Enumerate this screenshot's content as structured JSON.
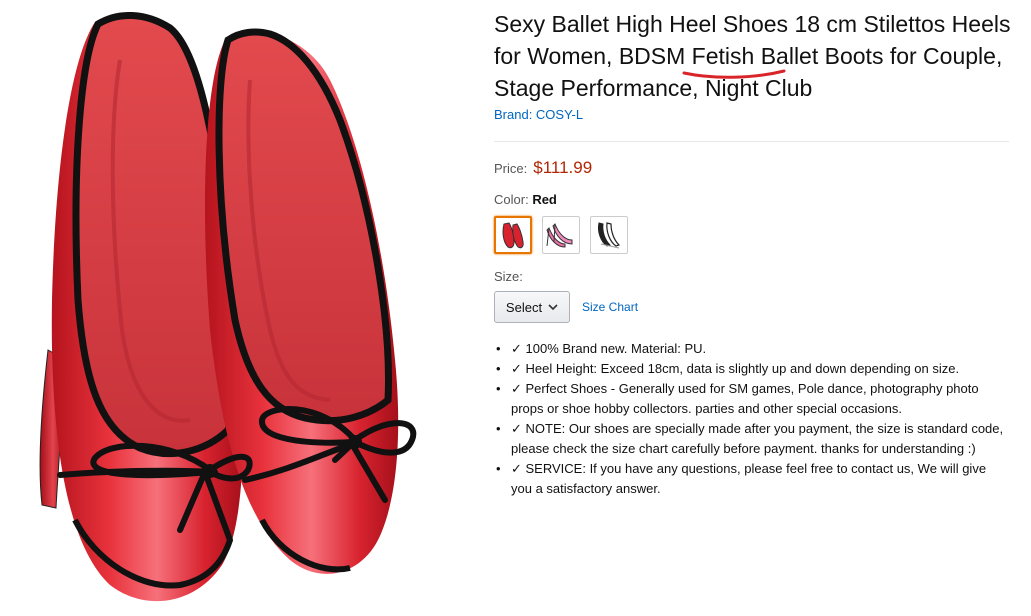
{
  "product": {
    "title": "Sexy Ballet High Heel Shoes 18 cm Stilettos Heels for Women, BDSM Fetish Ballet Boots for Couple, Stage Performance, Night Club",
    "brand": "Brand: COSY-L",
    "price_label": "Price:",
    "price": "$111.99",
    "color_label": "Color:",
    "color_value": "Red",
    "swatches": [
      {
        "name": "Red",
        "color": "#d8232f"
      },
      {
        "name": "Pink",
        "color": "#e96fa8"
      },
      {
        "name": "Black/White",
        "color": "#222222"
      }
    ],
    "size_label": "Size:",
    "size_select": "Select",
    "size_chart": "Size Chart",
    "bullets": [
      "✓ 100% Brand new. Material: PU.",
      "✓ Heel Height: Exceed 18cm, data is slightly up and down depending on size.",
      "✓ Perfect Shoes - Generally used for SM games, Pole dance, photography photo props or shoe hobby collectors. parties and other special occasions.",
      "✓ NOTE: Our shoes are specially made after you payment, the size is standard code, please check the size chart carefully before payment. thanks for understanding :)",
      "✓ SERVICE: If you have any questions, please feel free to contact us, We will give you a satisfactory answer."
    ]
  },
  "colors": {
    "link": "#0066c0",
    "price": "#b12704",
    "shoe_red": "#d8232f",
    "annotation": "#d9252a"
  }
}
